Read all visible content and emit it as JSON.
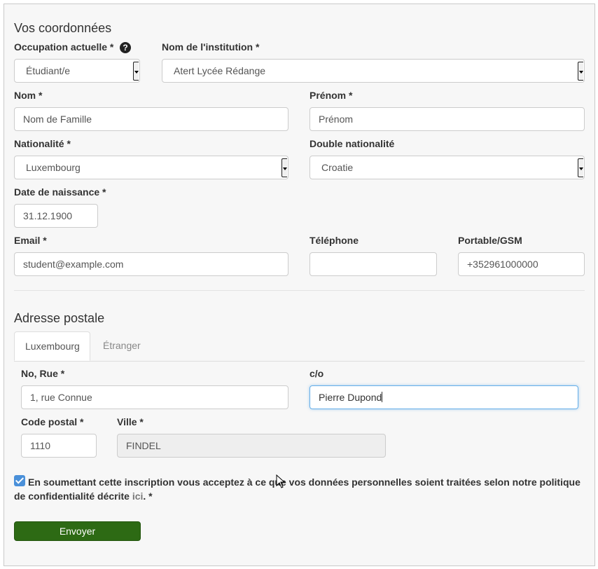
{
  "contact": {
    "title": "Vos coordonnées",
    "occupation": {
      "label": "Occupation actuelle *",
      "value": "Étudiant/e"
    },
    "institution": {
      "label": "Nom de l'institution *",
      "value": "Atert Lycée Rédange"
    },
    "nom": {
      "label": "Nom *",
      "placeholder": "Nom de Famille"
    },
    "prenom": {
      "label": "Prénom *",
      "placeholder": "Prénom"
    },
    "nationalite": {
      "label": "Nationalité *",
      "value": "Luxembourg"
    },
    "double_nationalite": {
      "label": "Double nationalité",
      "value": "Croatie"
    },
    "date_naissance": {
      "label": "Date de naissance *",
      "value": "31.12.1900"
    },
    "email": {
      "label": "Email *",
      "value": "student@example.com"
    },
    "telephone": {
      "label": "Téléphone",
      "value": ""
    },
    "portable": {
      "label": "Portable/GSM",
      "value": "+352961000000"
    }
  },
  "address": {
    "title": "Adresse postale",
    "tabs": [
      {
        "label": "Luxembourg",
        "active": true
      },
      {
        "label": "Étranger",
        "active": false
      }
    ],
    "rue": {
      "label": "No, Rue *",
      "value": "1, rue Connue"
    },
    "co": {
      "label": "c/o",
      "value": "Pierre Dupond"
    },
    "code_postal": {
      "label": "Code postal *",
      "value": "1110"
    },
    "ville": {
      "label": "Ville *",
      "value": "FINDEL"
    }
  },
  "consent": {
    "checked": true,
    "text": "En soumettant cette inscription vous acceptez à ce que vos données personnelles soient traitées selon notre politique de confidentialité décrite ",
    "link": "ici",
    "suffix": ". *"
  },
  "submit": {
    "label": "Envoyer"
  },
  "colors": {
    "submit": "#2d6a14",
    "checkbox": "#4a90d9",
    "focus": "#66afe9"
  }
}
